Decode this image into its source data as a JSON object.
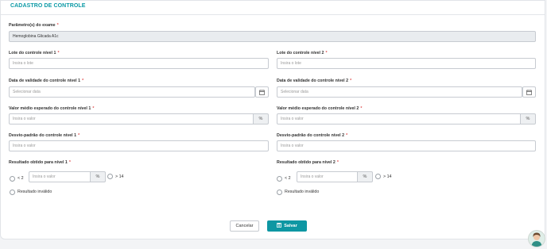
{
  "header": {
    "title": "CADASTRO DE CONTROLE"
  },
  "param": {
    "label": "Parâmetro(s) do exame",
    "required": "*",
    "value": "Hemoglobina Glicada A1c"
  },
  "lot": {
    "n1": {
      "label": "Lote do controle nível 1",
      "required": "*",
      "placeholder": "Insira o lote"
    },
    "n2": {
      "label": "Lote do controle nível 2",
      "required": "*",
      "placeholder": "Insira o lote"
    }
  },
  "validity": {
    "n1": {
      "label": "Data de validade do controle nível 1",
      "required": "*",
      "placeholder": "Selecionar data",
      "icon": "calendar-icon"
    },
    "n2": {
      "label": "Data de validade do controle nível 2",
      "required": "*",
      "placeholder": "Selecionar data",
      "icon": "calendar-icon"
    }
  },
  "mean": {
    "n1": {
      "label": "Valor médio esperado do controle nível 1",
      "required": "*",
      "placeholder": "Insira o valor",
      "unit": "%"
    },
    "n2": {
      "label": "Valor médio esperado do controle nível 2",
      "required": "*",
      "placeholder": "Insira o valor",
      "unit": "%"
    }
  },
  "sd": {
    "n1": {
      "label": "Desvio-padrão do controle nível 1",
      "required": "*",
      "placeholder": "Insira o valor"
    },
    "n2": {
      "label": "Desvio-padrão do controle nível 2",
      "required": "*",
      "placeholder": "Insira o valor"
    }
  },
  "result": {
    "n1": {
      "label": "Resultado obtido para nível 1",
      "required": "*",
      "lt": "< 2",
      "placeholder": "Insira o valor",
      "unit": "%",
      "gt": "> 14",
      "invalid": "Resultado inválido"
    },
    "n2": {
      "label": "Resultado obtido para nível 2",
      "required": "*",
      "lt": "< 2",
      "placeholder": "Insira o valor",
      "unit": "%",
      "gt": "> 14",
      "invalid": "Resultado inválido"
    }
  },
  "actions": {
    "cancel": "Cancelar",
    "save": "Salvar",
    "save_icon": "save-icon"
  },
  "colors": {
    "accent": "#0e97a3",
    "required": "#e05252"
  }
}
